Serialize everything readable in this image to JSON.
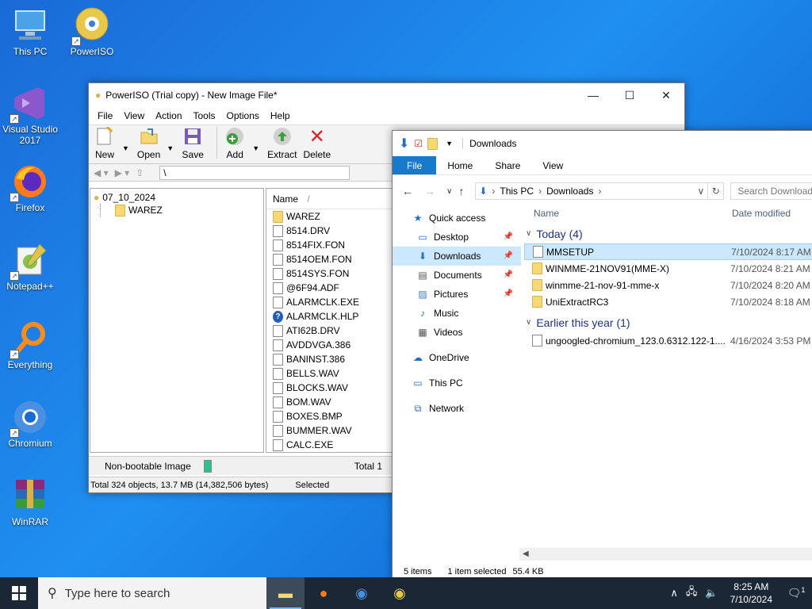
{
  "desktop": {
    "icons": [
      {
        "label": "This PC"
      },
      {
        "label": "PowerISO"
      },
      {
        "label": "Visual Studio 2017"
      },
      {
        "label": "Firefox"
      },
      {
        "label": "Notepad++"
      },
      {
        "label": "Everything"
      },
      {
        "label": "Chromium"
      },
      {
        "label": "WinRAR"
      }
    ]
  },
  "poweriso": {
    "title": "PowerISO (Trial copy) - New Image File*",
    "menu": [
      "File",
      "View",
      "Action",
      "Tools",
      "Options",
      "Help"
    ],
    "toolbar": [
      "New",
      "Open",
      "Save",
      "Add",
      "Extract",
      "Delete"
    ],
    "path": "\\",
    "tree": {
      "root": "07_10_2024",
      "child": "WAREZ"
    },
    "list_header": "Name",
    "files": [
      {
        "name": "WAREZ",
        "icon": "folder"
      },
      {
        "name": "8514.DRV",
        "icon": "file"
      },
      {
        "name": "8514FIX.FON",
        "icon": "font"
      },
      {
        "name": "8514OEM.FON",
        "icon": "font"
      },
      {
        "name": "8514SYS.FON",
        "icon": "font"
      },
      {
        "name": "@6F94.ADF",
        "icon": "file"
      },
      {
        "name": "ALARMCLK.EXE",
        "icon": "exe"
      },
      {
        "name": "ALARMCLK.HLP",
        "icon": "help"
      },
      {
        "name": "ATI62B.DRV",
        "icon": "file"
      },
      {
        "name": "AVDDVGA.386",
        "icon": "file"
      },
      {
        "name": "BANINST.386",
        "icon": "file"
      },
      {
        "name": "BELLS.WAV",
        "icon": "wav"
      },
      {
        "name": "BLOCKS.WAV",
        "icon": "wav"
      },
      {
        "name": "BOM.WAV",
        "icon": "wav"
      },
      {
        "name": "BOXES.BMP",
        "icon": "bmp"
      },
      {
        "name": "BUMMER.WAV",
        "icon": "wav"
      },
      {
        "name": "CALC.EXE",
        "icon": "exe"
      }
    ],
    "status_image": "Non-bootable Image",
    "status_total": "Total 1",
    "status_summary": "Total 324 objects, 13.7 MB (14,382,506 bytes)",
    "status_selected": "Selected"
  },
  "explorer": {
    "title": "Downloads",
    "tabs": [
      "File",
      "Home",
      "Share",
      "View"
    ],
    "breadcrumb": [
      "This PC",
      "Downloads"
    ],
    "search_placeholder": "Search Downloads",
    "nav": [
      {
        "label": "Quick access",
        "icon": "star",
        "indent": false,
        "pin": false,
        "selected": false
      },
      {
        "label": "Desktop",
        "icon": "desktop",
        "indent": true,
        "pin": true,
        "selected": false
      },
      {
        "label": "Downloads",
        "icon": "download",
        "indent": true,
        "pin": true,
        "selected": true
      },
      {
        "label": "Documents",
        "icon": "document",
        "indent": true,
        "pin": true,
        "selected": false
      },
      {
        "label": "Pictures",
        "icon": "picture",
        "indent": true,
        "pin": true,
        "selected": false
      },
      {
        "label": "Music",
        "icon": "music",
        "indent": true,
        "pin": false,
        "selected": false
      },
      {
        "label": "Videos",
        "icon": "video",
        "indent": true,
        "pin": false,
        "selected": false
      },
      {
        "label": "OneDrive",
        "icon": "cloud",
        "indent": false,
        "pin": false,
        "selected": false
      },
      {
        "label": "This PC",
        "icon": "pc",
        "indent": false,
        "pin": false,
        "selected": false
      },
      {
        "label": "Network",
        "icon": "network",
        "indent": false,
        "pin": false,
        "selected": false
      }
    ],
    "columns": {
      "name": "Name",
      "date": "Date modified"
    },
    "groups": [
      {
        "title": "Today (4)",
        "files": [
          {
            "name": "MMSETUP",
            "date": "7/10/2024 8:17 AM",
            "icon": "exe",
            "selected": true
          },
          {
            "name": "WINMME-21NOV91(MME-X)",
            "date": "7/10/2024 8:21 AM",
            "icon": "folder",
            "selected": false
          },
          {
            "name": "winmme-21-nov-91-mme-x",
            "date": "7/10/2024 8:20 AM",
            "icon": "folder",
            "selected": false
          },
          {
            "name": "UniExtractRC3",
            "date": "7/10/2024 8:18 AM",
            "icon": "folder",
            "selected": false
          }
        ]
      },
      {
        "title": "Earlier this year (1)",
        "files": [
          {
            "name": "ungoogled-chromium_123.0.6312.122-1....",
            "date": "4/16/2024 3:53 PM",
            "icon": "archive",
            "selected": false
          }
        ]
      }
    ],
    "status_items": "5 items",
    "status_selected": "1 item selected",
    "status_size": "55.4 KB"
  },
  "taskbar": {
    "search_placeholder": "Type here to search",
    "time": "8:25 AM",
    "date": "7/10/2024",
    "notification_count": "1"
  }
}
